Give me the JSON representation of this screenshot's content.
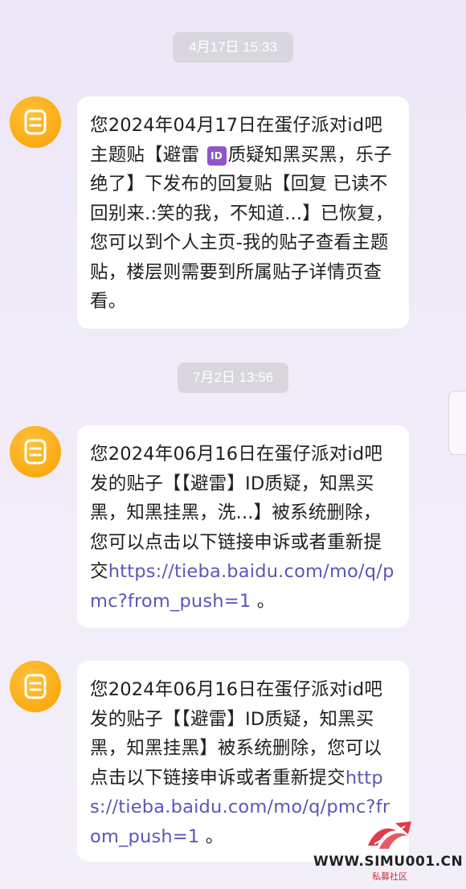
{
  "messages": [
    {
      "timestamp": "4月17日 15:33",
      "text_parts": [
        "您2024年04月17日在蛋仔派对id吧主题贴【避雷 ",
        "质疑知黑买黑，乐子绝了】下发布的回复贴【回复 已读不回别来.:笑的我，不知道...】已恢复，您可以到个人主页-我的贴子查看主题贴，楼层则需要到所属贴子详情页查看。"
      ],
      "id_badge": "ID"
    },
    {
      "timestamp": "7月2日 13:56",
      "text": "您2024年06月16日在蛋仔派对id吧发的贴子【【避雷】ID质疑，知黑买黑，知黑挂黑，洗...】被系统删除，您可以点击以下链接申诉或者重新提交",
      "link": "https://tieba.baidu.com/mo/q/pmc?from_push=1",
      "suffix": " 。"
    },
    {
      "text": "您2024年06月16日在蛋仔派对id吧发的贴子【【避雷】ID质疑，知黑买黑，知黑挂黑】被系统删除，您可以点击以下链接申诉或者重新提交",
      "link": "https://tieba.baidu.com/mo/q/pmc?from_push=1",
      "suffix": " 。"
    }
  ],
  "watermark": {
    "site": "WWW.SIMU001.CN",
    "sub": "私募社区"
  },
  "colors": {
    "avatar": "#fbab12",
    "link": "#5a57b8",
    "pill": "#d9d6de"
  },
  "icons": {
    "avatar": "notice-document-icon",
    "badge": "id-emoji-icon"
  }
}
